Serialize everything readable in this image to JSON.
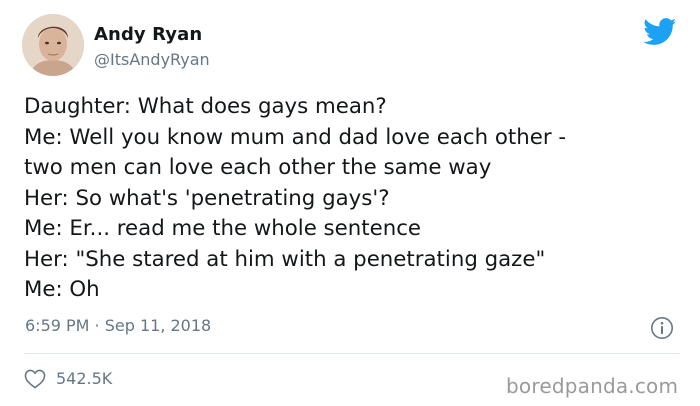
{
  "author": {
    "display_name": "Andy Ryan",
    "handle": "@ItsAndyRyan"
  },
  "tweet": {
    "lines": [
      "Daughter: What does gays mean?",
      "Me: Well you know mum and dad love each other -",
      "two men can love each other the same way",
      "Her: So what's 'penetrating gays'?",
      "Me: Er... read me the whole sentence",
      "Her: \"She stared at him with a penetrating gaze\"",
      "Me: Oh"
    ],
    "timestamp": "6:59 PM · Sep 11, 2018",
    "likes": "542.5K"
  },
  "watermark": "boredpanda.com",
  "icons": {
    "brand": "twitter-bird-icon",
    "info": "info-icon",
    "like": "heart-icon"
  },
  "colors": {
    "twitter_blue": "#1da1f2",
    "secondary_text": "#657786",
    "primary_text": "#14171a",
    "divider": "#e1e8ed"
  }
}
